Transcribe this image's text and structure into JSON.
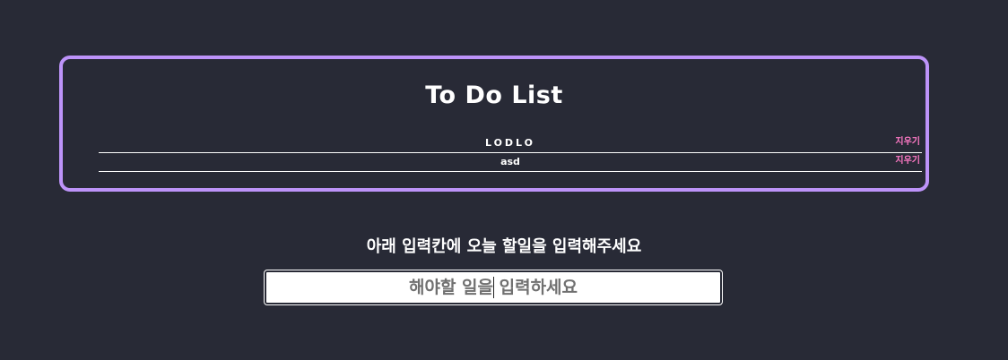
{
  "todo": {
    "title": "To Do List",
    "items": [
      {
        "text": "LODLO",
        "delete_label": "지우기"
      },
      {
        "text": "asd",
        "delete_label": "지우기"
      }
    ]
  },
  "input_section": {
    "prompt": "아래 입력칸에 오늘 할일을 입력해주세요",
    "placeholder": "해야할 일을 입력하세요",
    "value": ""
  },
  "colors": {
    "background": "#282a36",
    "border_accent": "#bd93f9",
    "delete_accent": "#ff79c6",
    "text": "#ffffff"
  }
}
